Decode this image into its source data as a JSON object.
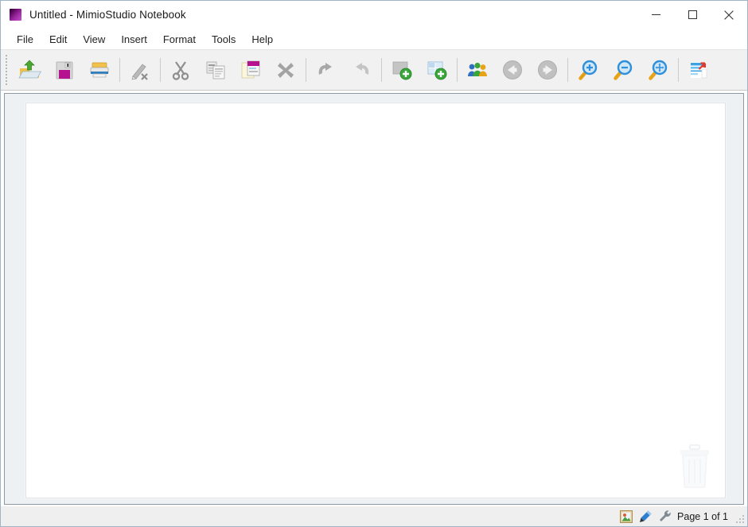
{
  "window": {
    "title": "Untitled - MimioStudio Notebook",
    "app_icon": "mimio-logo-icon",
    "controls": {
      "minimize": "minimize-icon",
      "maximize": "maximize-icon",
      "close": "close-icon"
    }
  },
  "menubar": {
    "items": [
      {
        "label": "File"
      },
      {
        "label": "Edit"
      },
      {
        "label": "View"
      },
      {
        "label": "Insert"
      },
      {
        "label": "Format"
      },
      {
        "label": "Tools"
      },
      {
        "label": "Help"
      }
    ]
  },
  "toolbar": {
    "buttons": [
      {
        "name": "open-file-button",
        "icon": "open-folder-icon",
        "enabled": true
      },
      {
        "name": "save-button",
        "icon": "floppy-disk-save-icon",
        "enabled": true
      },
      {
        "name": "print-button",
        "icon": "printer-icon",
        "enabled": true
      },
      {
        "name": "clear-ink-button",
        "icon": "pen-erase-icon",
        "enabled": false
      },
      {
        "name": "cut-button",
        "icon": "scissors-icon",
        "enabled": false
      },
      {
        "name": "copy-button",
        "icon": "copy-document-icon",
        "enabled": false
      },
      {
        "name": "paste-button",
        "icon": "paste-clipboard-icon",
        "enabled": true
      },
      {
        "name": "delete-button",
        "icon": "delete-x-icon",
        "enabled": false
      },
      {
        "name": "undo-button",
        "icon": "undo-arrow-icon",
        "enabled": false
      },
      {
        "name": "redo-button",
        "icon": "redo-arrow-icon",
        "enabled": false
      },
      {
        "name": "new-page-button",
        "icon": "new-page-plus-icon",
        "enabled": true
      },
      {
        "name": "duplicate-page-button",
        "icon": "duplicate-page-plus-icon",
        "enabled": true
      },
      {
        "name": "collaborate-button",
        "icon": "group-people-icon",
        "enabled": true
      },
      {
        "name": "previous-page-button",
        "icon": "arrow-left-circle-icon",
        "enabled": false
      },
      {
        "name": "next-page-button",
        "icon": "arrow-right-circle-icon",
        "enabled": false
      },
      {
        "name": "zoom-in-button",
        "icon": "magnifier-plus-icon",
        "enabled": true
      },
      {
        "name": "zoom-out-button",
        "icon": "magnifier-minus-icon",
        "enabled": true
      },
      {
        "name": "zoom-fit-button",
        "icon": "magnifier-fit-icon",
        "enabled": true
      },
      {
        "name": "full-screen-button",
        "icon": "fullscreen-export-icon",
        "enabled": true
      }
    ],
    "separator_after_indexes": [
      2,
      3,
      7,
      9,
      11,
      12,
      14,
      17
    ]
  },
  "canvas": {
    "page_watermark": "trash-can-icon"
  },
  "statusbar": {
    "gallery_icon": "gallery-picture-icon",
    "pen_icon": "pen-tool-icon",
    "tools_icon": "wrench-tool-icon",
    "page_text": "Page 1 of 1",
    "resize_grip": "resize-grip-icon"
  },
  "colors": {
    "titlebar_bg": "#ffffff",
    "toolbar_bg": "#f1f1f1",
    "workspace_bg": "#eef1f4",
    "page_bg": "#ffffff",
    "statusbar_bg": "#efefef",
    "window_border": "#9fb4c6",
    "accent_magenta": "#b5128f",
    "accent_green": "#3aa63a",
    "accent_blue": "#2f8fd8",
    "accent_orange": "#e8a317",
    "disabled_gray": "#9a9a9a"
  }
}
